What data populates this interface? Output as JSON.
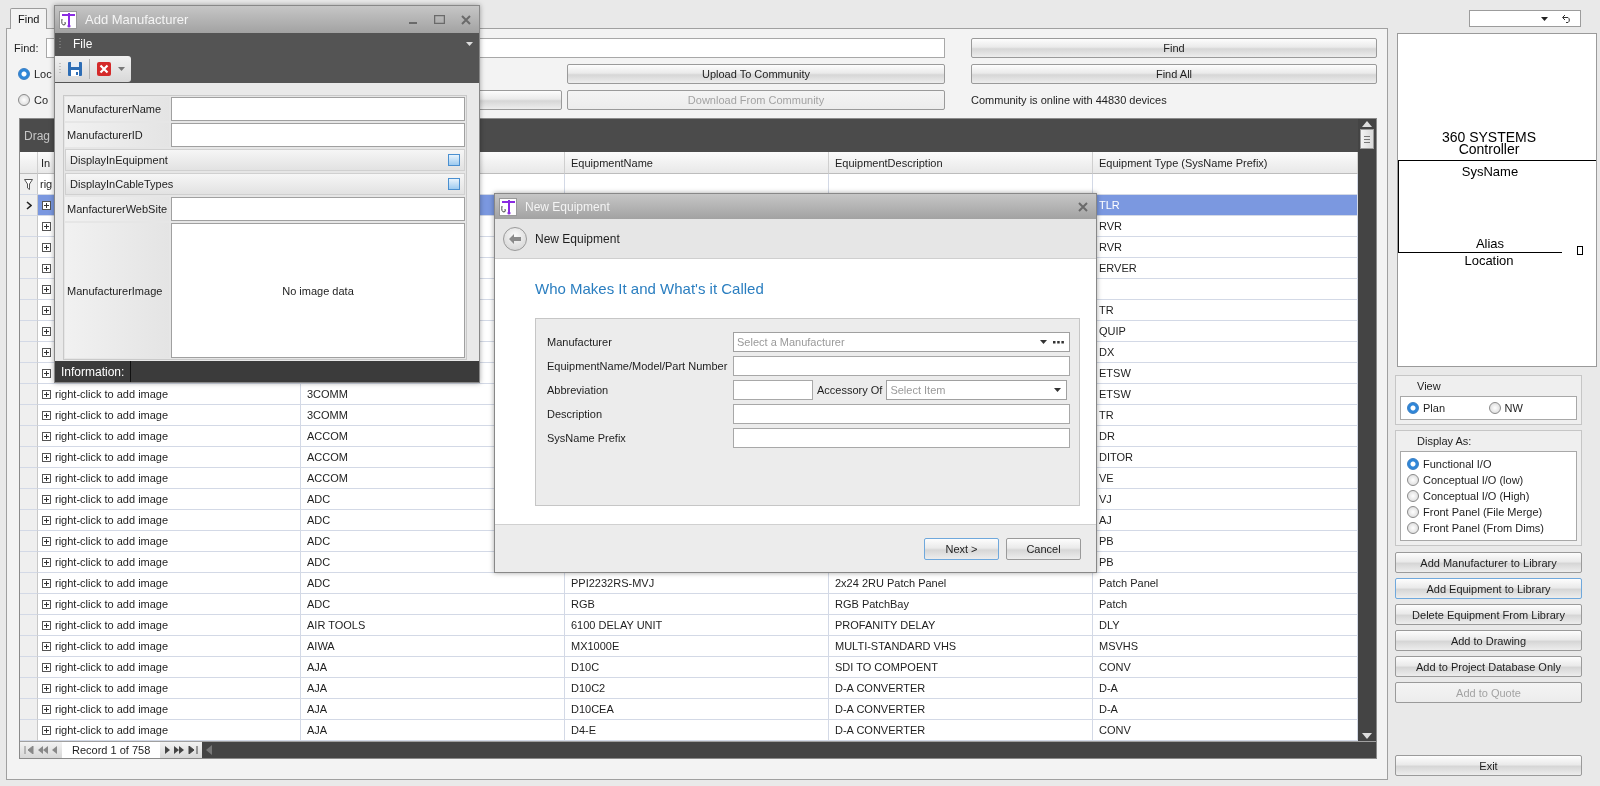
{
  "tabs": [
    {
      "label": "Find",
      "selected": true
    }
  ],
  "search": {
    "label": "Find:"
  },
  "source_options": [
    {
      "label": "Loc",
      "selected": true
    },
    {
      "label": "Co",
      "selected": false
    }
  ],
  "community_buttons": [
    {
      "label": "Upload To Community",
      "disabled": false
    },
    {
      "label": "Download From Community",
      "disabled": true
    }
  ],
  "find_buttons": [
    {
      "label": "Find"
    },
    {
      "label": "Find All"
    }
  ],
  "community_status": "Community is online with 44830 devices",
  "grid": {
    "group_panel": "Drag",
    "columns": [
      "In",
      null,
      "EquipmentName",
      "EquipmentDescription",
      "Equipment Type (SysName Prefix)"
    ],
    "filter": "rig",
    "rows": [
      {
        "selected": true,
        "cells": [
          null,
          null,
          null,
          null,
          "TLR"
        ]
      },
      {
        "selected": false,
        "cells": [
          null,
          null,
          null,
          null,
          "RVR"
        ]
      },
      {
        "selected": false,
        "cells": [
          null,
          null,
          null,
          null,
          "RVR"
        ]
      },
      {
        "selected": false,
        "cells": [
          null,
          null,
          null,
          null,
          "ERVER"
        ]
      },
      {
        "selected": false,
        "cells": [
          null,
          null,
          null,
          null,
          null
        ]
      },
      {
        "selected": false,
        "cells": [
          null,
          null,
          null,
          null,
          "TR"
        ]
      },
      {
        "selected": false,
        "cells": [
          null,
          null,
          null,
          null,
          "QUIP"
        ]
      },
      {
        "selected": false,
        "cells": [
          null,
          null,
          null,
          null,
          "DX"
        ]
      },
      {
        "selected": false,
        "cells": [
          null,
          null,
          null,
          null,
          "ETSW"
        ]
      },
      {
        "selected": false,
        "cells": [
          "right-click to add image",
          "3COMM",
          null,
          null,
          "ETSW"
        ]
      },
      {
        "selected": false,
        "cells": [
          "right-click to add image",
          "3COMM",
          null,
          null,
          "TR"
        ]
      },
      {
        "selected": false,
        "cells": [
          "right-click to add image",
          "ACCOM",
          null,
          null,
          "DR"
        ]
      },
      {
        "selected": false,
        "cells": [
          "right-click to add image",
          "ACCOM",
          null,
          null,
          "DITOR"
        ]
      },
      {
        "selected": false,
        "cells": [
          "right-click to add image",
          "ACCOM",
          null,
          null,
          "VE"
        ]
      },
      {
        "selected": false,
        "cells": [
          "right-click to add image",
          "ADC",
          null,
          null,
          "VJ"
        ]
      },
      {
        "selected": false,
        "cells": [
          "right-click to add image",
          "ADC",
          null,
          null,
          "AJ"
        ]
      },
      {
        "selected": false,
        "cells": [
          "right-click to add image",
          "ADC",
          null,
          null,
          "PB"
        ]
      },
      {
        "selected": false,
        "cells": [
          "right-click to add image",
          "ADC",
          null,
          null,
          "PB"
        ]
      },
      {
        "selected": false,
        "cells": [
          "right-click to add image",
          "ADC",
          "PPI2232RS-MVJ",
          "2x24 2RU Patch Panel",
          "Patch Panel"
        ]
      },
      {
        "selected": false,
        "cells": [
          "right-click to add image",
          "ADC",
          "RGB",
          "RGB PatchBay",
          "Patch"
        ]
      },
      {
        "selected": false,
        "cells": [
          "right-click to add image",
          "AIR TOOLS",
          "6100 DELAY UNIT",
          "PROFANITY DELAY",
          "DLY"
        ]
      },
      {
        "selected": false,
        "cells": [
          "right-click to add image",
          "AIWA",
          "MX1000E",
          "MULTI-STANDARD VHS",
          "MSVHS"
        ]
      },
      {
        "selected": false,
        "cells": [
          "right-click to add image",
          "AJA",
          "D10C",
          "SDI TO COMPOENT",
          "CONV"
        ]
      },
      {
        "selected": false,
        "cells": [
          "right-click to add image",
          "AJA",
          "D10C2",
          "D-A CONVERTER",
          "D-A"
        ]
      },
      {
        "selected": false,
        "cells": [
          "right-click to add image",
          "AJA",
          "D10CEA",
          "D-A CONVERTER",
          "D-A"
        ]
      },
      {
        "selected": false,
        "cells": [
          "right-click to add image",
          "AJA",
          "D4-E",
          "D-A CONVERTER",
          "CONV"
        ]
      }
    ],
    "record": "Record 1 of 758"
  },
  "preview": {
    "title_lines": [
      "360 SYSTEMS",
      "Controller"
    ],
    "sysname": "SysName",
    "alias": "Alias",
    "location": "Location"
  },
  "view": {
    "title": "View",
    "options": [
      {
        "label": "Plan",
        "selected": true
      },
      {
        "label": "NW",
        "selected": false
      }
    ]
  },
  "display_as": {
    "title": "Display As:",
    "options": [
      {
        "label": "Functional I/O",
        "selected": true
      },
      {
        "label": "Conceptual I/O (low)",
        "selected": false
      },
      {
        "label": "Conceptual I/O (High)",
        "selected": false
      },
      {
        "label": "Front Panel (File Merge)",
        "selected": false
      },
      {
        "label": "Front Panel (From Dims)",
        "selected": false
      }
    ]
  },
  "actions": [
    {
      "label": "Add Manufacturer to Library",
      "disabled": false,
      "focused": false
    },
    {
      "label": "Add Equipment to Library",
      "disabled": false,
      "focused": true
    },
    {
      "label": "Delete Equipment From Library",
      "disabled": false,
      "focused": false
    },
    {
      "label": "Add to Drawing",
      "disabled": false,
      "focused": false
    },
    {
      "label": "Add to Project Database Only",
      "disabled": false,
      "focused": false
    },
    {
      "label": "Add to Quote",
      "disabled": true,
      "focused": false
    }
  ],
  "exit_button": {
    "label": "Exit"
  },
  "add_manufacturer": {
    "title": "Add Manufacturer",
    "menu": [
      "File"
    ],
    "fields": [
      {
        "kind": "text",
        "label": "ManufacturerName"
      },
      {
        "kind": "text",
        "label": "ManufacturerID"
      },
      {
        "kind": "check",
        "label": "DisplayInEquipment",
        "checked": false
      },
      {
        "kind": "check",
        "label": "DisplayInCableTypes",
        "checked": false
      },
      {
        "kind": "text",
        "label": "ManfacturerWebSite"
      },
      {
        "kind": "image",
        "label": "ManufacturerImage",
        "placeholder": "No image data"
      }
    ],
    "information": "Information:"
  },
  "new_equipment": {
    "title": "New Equipment",
    "header": "New Equipment",
    "heading": "Who Makes It and What's it Called",
    "fields": [
      {
        "kind": "combo",
        "label": "Manufacturer",
        "placeholder": "Select a Manufacturer",
        "browse": true
      },
      {
        "kind": "text",
        "label": "EquipmentName/Model/Part Number"
      },
      {
        "kind": "split",
        "label": "Abbreviation",
        "extra_label": "Accessory Of",
        "extra_placeholder": "Select Item"
      },
      {
        "kind": "text",
        "label": "Description"
      },
      {
        "kind": "text",
        "label": "SysName Prefix"
      }
    ],
    "buttons": [
      {
        "label": "Next >",
        "default": true
      },
      {
        "label": "Cancel",
        "default": false
      }
    ]
  }
}
